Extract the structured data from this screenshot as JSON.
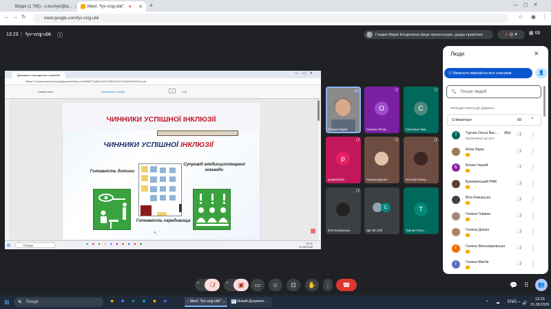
{
  "browser": {
    "tabs": [
      {
        "label": "Вхідні (1 785) - o.turchyn@ip...",
        "color": "#d93025"
      },
      {
        "label": "Meet: \"fyv-vzqj-ubk\"",
        "color": "#f9ab00"
      }
    ],
    "new_tab": "+",
    "url": "meet.google.com/fyv-vzqj-ubk"
  },
  "meet": {
    "time": "13:23",
    "separator": "|",
    "code": "fyv-vzqj-ubk",
    "presenter_initial": "Г",
    "presenter_text": "Гладик Марія Богданівна (веде презентацію, додає примітки)",
    "grid_count": "68"
  },
  "shared_screen": {
    "tab_label": "Допомога з методичних стратегій",
    "address": "Файл   C:/Users/user/Desktop/Докази%20кооп%20МЕТОДИ%20УСПІШНОСТІ%2020%20%20.pdf",
    "toolbar_view": "Накреслити",
    "toolbar_copilot": "Запитати в Copilot",
    "page_current": "1",
    "page_total": "з 13",
    "search_label": "Пошук",
    "clock_time": "13:21",
    "clock_date": "21.08.2026",
    "slide": {
      "banner": "ЧИННИКИ УСПІШНОЇ ІНКЛЮЗІЇ",
      "title_part1": "ЧИННИКИ УСПІШНОЇ",
      "title_part2": "ІНКЛЮЗІЇ",
      "left_label": "Готовність дитини",
      "center_label": "Готовність середовища",
      "right_label": "Супровід міждисциплінарної команди"
    }
  },
  "tiles": [
    {
      "name": "Гладик Марія",
      "initial": "",
      "bg": "#8a8a8a"
    },
    {
      "name": "Оксана Петрі...",
      "initial": "О",
      "bg": "#7b1fa2"
    },
    {
      "name": "Світлана Оме...",
      "initial": "С",
      "bg": "#00695c"
    },
    {
      "name": "pogiko0526",
      "initial": "p",
      "bg": "#e91e63"
    },
    {
      "name": "Галина Дяшко",
      "initial": "",
      "bg": "#b08560"
    },
    {
      "name": "Наталія Олек...",
      "initial": "",
      "bg": "#6d4c41"
    },
    {
      "name": "Віта Ковєрська",
      "initial": "",
      "bg": "#4a4a4a"
    },
    {
      "name": "Ще 59 осіб",
      "initial": "С",
      "bg": "#3c4043"
    },
    {
      "name": "Турчин Ольг...",
      "initial": "Т",
      "bg": "#00695c"
    }
  ],
  "people_panel": {
    "title": "Люди",
    "mute_all": "Вимкнути мікрофони всіх учасників",
    "search_placeholder": "Пошук людей",
    "section_label": "ПРИЄДНАЛИСЯ ДО ДЗВІНКА",
    "group_label": "Співавтори",
    "group_count": "68",
    "participants": [
      {
        "name": "Турчин Ольга Вас...",
        "you": "(Ви)",
        "sub": "Організатор зустрічі",
        "initial": "Т",
        "color": "#00695c"
      },
      {
        "name": "Алла Яцюк",
        "you": "",
        "sub": "",
        "initial": "",
        "color": "#9c7b5a"
      },
      {
        "name": "Бозюк Чорній",
        "you": "",
        "sub": "",
        "initial": "Б",
        "color": "#8e24aa"
      },
      {
        "name": "Буковинський РМК",
        "you": "",
        "sub": "",
        "initial": "",
        "color": "#5d4037"
      },
      {
        "name": "Віта Ковєрська",
        "you": "",
        "sub": "",
        "initial": "",
        "color": "#424242"
      },
      {
        "name": "Галина Герман",
        "you": "",
        "sub": "",
        "initial": "",
        "color": "#a1887f"
      },
      {
        "name": "Галина Дяшко",
        "you": "",
        "sub": "",
        "initial": "",
        "color": "#b08560"
      },
      {
        "name": "Галина Жихномровська",
        "you": "",
        "sub": "",
        "initial": "Г",
        "color": "#ef6c00"
      },
      {
        "name": "Галина Матіїв",
        "you": "",
        "sub": "",
        "initial": "Г",
        "color": "#5c6bc0"
      }
    ]
  },
  "taskbar": {
    "search": "Пошук",
    "app1": "Meet: \"fyv-vzqj-ubk\" ...",
    "app2": "Новий Документ ...",
    "lang": "ENG",
    "time": "13:23",
    "date": "21.08.2026"
  }
}
